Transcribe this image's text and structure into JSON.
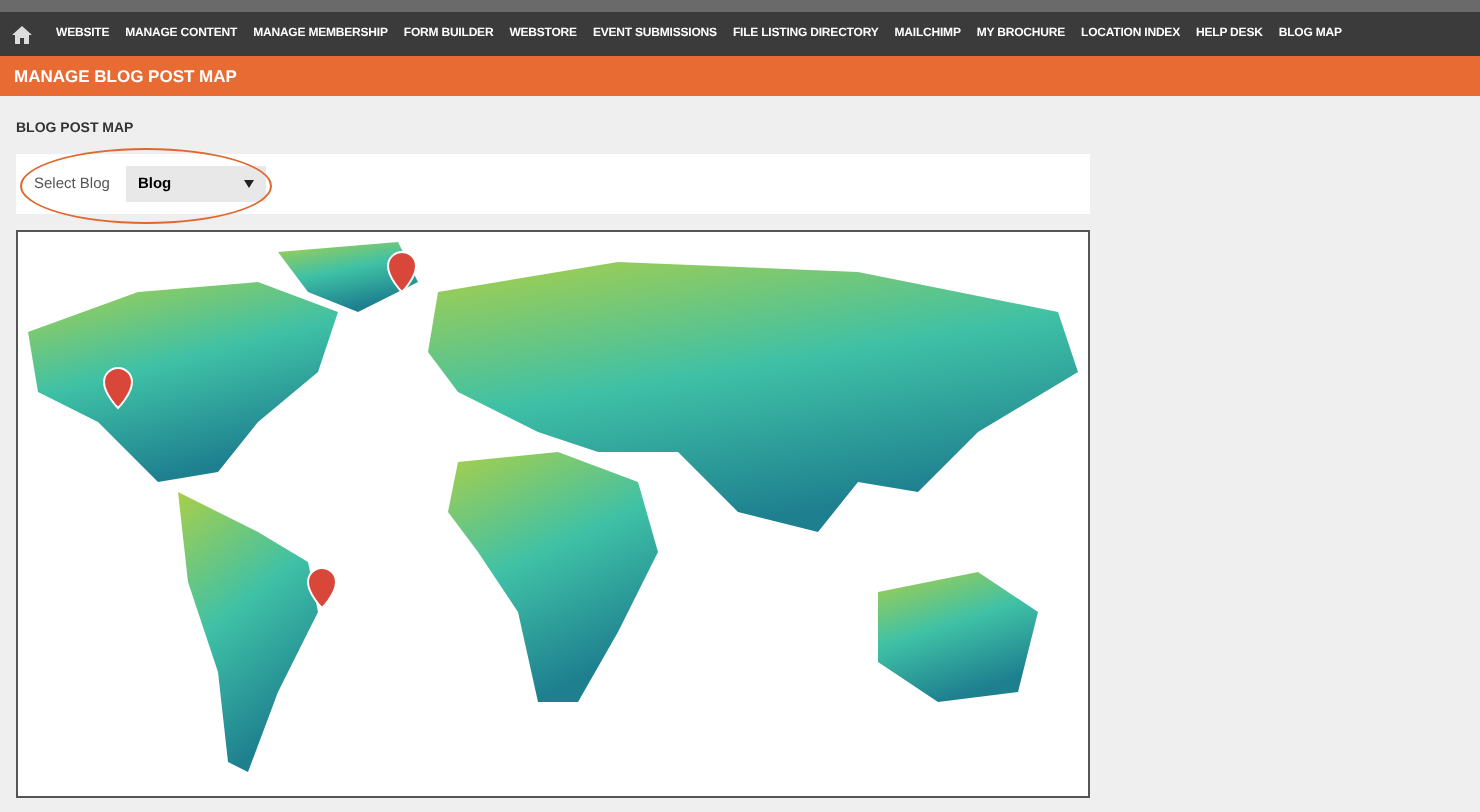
{
  "nav": {
    "items": [
      {
        "label": "WEBSITE"
      },
      {
        "label": "MANAGE CONTENT"
      },
      {
        "label": "MANAGE MEMBERSHIP"
      },
      {
        "label": "FORM BUILDER"
      },
      {
        "label": "WEBSTORE"
      },
      {
        "label": "EVENT SUBMISSIONS"
      },
      {
        "label": "FILE LISTING DIRECTORY"
      },
      {
        "label": "MAILCHIMP"
      },
      {
        "label": "MY BROCHURE"
      },
      {
        "label": "LOCATION INDEX"
      },
      {
        "label": "HELP DESK"
      },
      {
        "label": "BLOG MAP"
      }
    ]
  },
  "page_title": "MANAGE BLOG POST MAP",
  "section_title": "BLOG POST MAP",
  "select": {
    "label": "Select Blog",
    "value": "Blog"
  }
}
